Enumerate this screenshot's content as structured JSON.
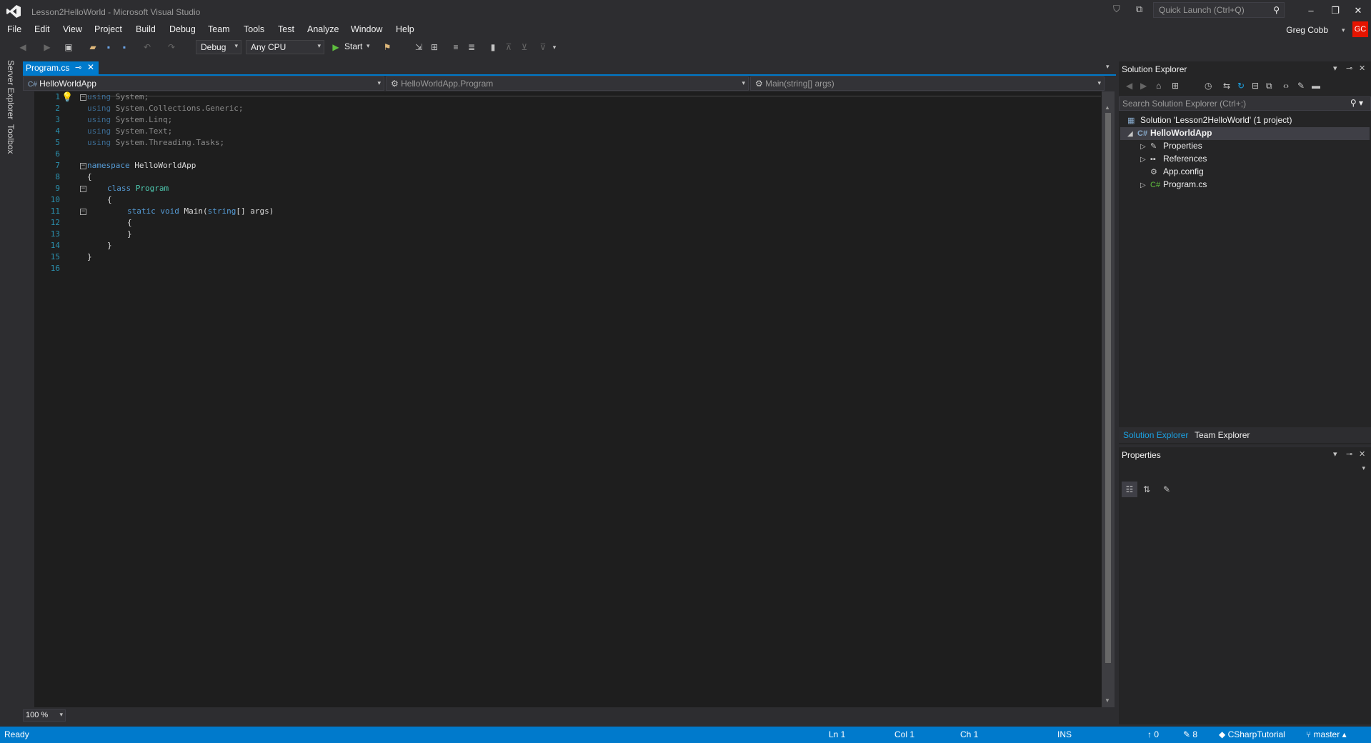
{
  "window": {
    "title": "Lesson2HelloWorld - Microsoft Visual Studio",
    "quick_launch_placeholder": "Quick Launch (Ctrl+Q)",
    "user_name": "Greg Cobb",
    "user_initials": "GC"
  },
  "menu": [
    "File",
    "Edit",
    "View",
    "Project",
    "Build",
    "Debug",
    "Team",
    "Tools",
    "Test",
    "Analyze",
    "Window",
    "Help"
  ],
  "toolbar": {
    "configuration": "Debug",
    "platform": "Any CPU",
    "start_label": "Start"
  },
  "left_tabs": [
    "Server Explorer",
    "Toolbox"
  ],
  "document_tab": {
    "label": "Program.cs"
  },
  "nav": {
    "project": "HelloWorldApp",
    "type": "HelloWorldApp.Program",
    "member": "Main(string[] args)"
  },
  "code_lines": [
    {
      "n": "1"
    },
    {
      "n": "2"
    },
    {
      "n": "3"
    },
    {
      "n": "4"
    },
    {
      "n": "5"
    },
    {
      "n": "6"
    },
    {
      "n": "7"
    },
    {
      "n": "8"
    },
    {
      "n": "9"
    },
    {
      "n": "10"
    },
    {
      "n": "11"
    },
    {
      "n": "12"
    },
    {
      "n": "13"
    },
    {
      "n": "14"
    },
    {
      "n": "15"
    },
    {
      "n": "16"
    }
  ],
  "code": {
    "l1_kw": "using",
    "l1_rest": " System;",
    "l2_kw": "using",
    "l2_rest": " System.Collections.Generic;",
    "l3_kw": "using",
    "l3_rest": " System.Linq;",
    "l4_kw": "using",
    "l4_rest": " System.Text;",
    "l5_kw": "using",
    "l5_rest": " System.Threading.Tasks;",
    "l7_kw": "namespace",
    "l7_rest": " HelloWorldApp",
    "l8": "{",
    "l9_kw": "class",
    "l9_cls": "Program",
    "l10": "{",
    "l11_kw1": "static",
    "l11_kw2": "void",
    "l11_name": "Main(",
    "l11_kw3": "string",
    "l11_rest": "[] args)",
    "l12": "{",
    "l13": "}",
    "l14": "}",
    "l15": "}"
  },
  "zoom": "100 %",
  "solution_explorer": {
    "title": "Solution Explorer",
    "search_placeholder": "Search Solution Explorer (Ctrl+;)",
    "items": [
      {
        "label": "Solution 'Lesson2HelloWorld' (1 project)"
      },
      {
        "label": "HelloWorldApp"
      },
      {
        "label": "Properties"
      },
      {
        "label": "References"
      },
      {
        "label": "App.config"
      },
      {
        "label": "Program.cs"
      }
    ],
    "tabs": [
      "Solution Explorer",
      "Team Explorer"
    ]
  },
  "properties": {
    "title": "Properties"
  },
  "status": {
    "state": "Ready",
    "line": "Ln 1",
    "col": "Col 1",
    "ch": "Ch 1",
    "mode": "INS",
    "pending_push": "0",
    "pending_changes": "8",
    "repo": "CSharpTutorial",
    "branch": "master"
  },
  "colors": {
    "accent": "#007acc",
    "background": "#2d2d30",
    "editor": "#1e1e1e",
    "keyword": "#569cd6",
    "type": "#4ec9b0",
    "line_number": "#2b91af"
  }
}
